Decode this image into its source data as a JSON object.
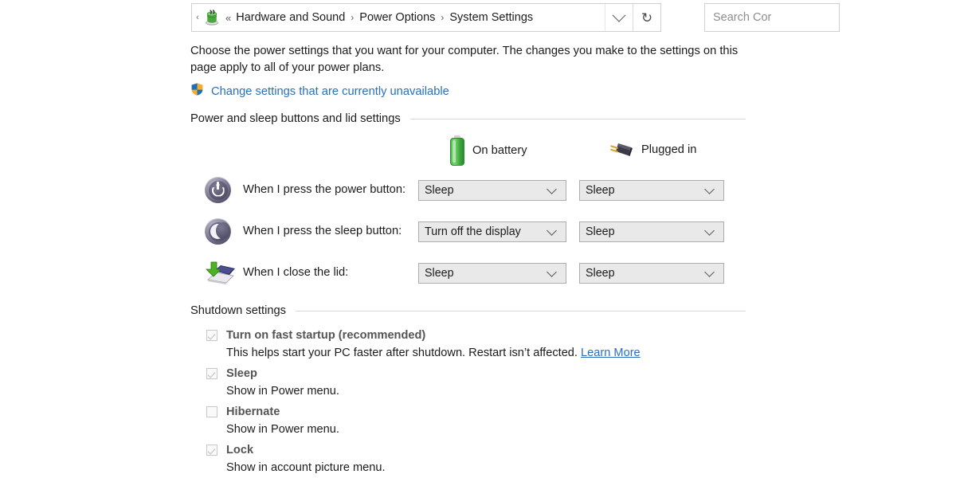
{
  "addressbar": {
    "back_chevron": "‹",
    "icon_name": "power-options-icon",
    "double_chevron": "«",
    "crumbs": [
      "Hardware and Sound",
      "Power Options",
      "System Settings"
    ],
    "separator": "›",
    "dropdown_icon": "chevron-down-icon",
    "refresh_icon": "refresh-icon",
    "refresh_glyph": "↻"
  },
  "search": {
    "placeholder": "Search Cor",
    "visible_text": "Search Cor"
  },
  "intro": {
    "text": "Choose the power settings that you want for your computer. The changes you make to the settings on this page apply to all of your power plans."
  },
  "uac": {
    "shield_icon": "uac-shield-icon",
    "link_text": "Change settings that are currently unavailable"
  },
  "sections": {
    "power": {
      "title": "Power and sleep buttons and lid settings"
    },
    "shutdown": {
      "title": "Shutdown settings"
    }
  },
  "columns": {
    "battery": {
      "label": "On battery",
      "icon": "battery-icon"
    },
    "plugged": {
      "label": "Plugged in",
      "icon": "power-plug-icon"
    }
  },
  "rows": [
    {
      "icon": "power-button-icon",
      "label": "When I press the power button:",
      "on_battery": "Sleep",
      "plugged_in": "Sleep"
    },
    {
      "icon": "sleep-moon-icon",
      "label": "When I press the sleep button:",
      "on_battery": "Turn off the display",
      "plugged_in": "Sleep"
    },
    {
      "icon": "laptop-lid-icon",
      "label": "When I close the lid:",
      "on_battery": "Sleep",
      "plugged_in": "Sleep"
    }
  ],
  "shutdown_options": [
    {
      "label": "Turn on fast startup (recommended)",
      "checked": true,
      "disabled": true,
      "desc_before": "This helps start your PC faster after shutdown. Restart isn’t affected. ",
      "desc_link": "Learn More"
    },
    {
      "label": "Sleep",
      "checked": true,
      "disabled": true,
      "desc_before": "Show in Power menu.",
      "desc_link": ""
    },
    {
      "label": "Hibernate",
      "checked": false,
      "disabled": true,
      "desc_before": "Show in Power menu.",
      "desc_link": ""
    },
    {
      "label": "Lock",
      "checked": true,
      "disabled": true,
      "desc_before": "Show in account picture menu.",
      "desc_link": ""
    }
  ],
  "colors": {
    "link": "#2a6fbb",
    "text": "#1b1b1b",
    "disabled_label": "#545454",
    "dropdown_bg": "#e9e9e9",
    "dropdown_border": "#adadad",
    "rule": "#d6d6d6",
    "battery_green": "#4fbd4f"
  }
}
